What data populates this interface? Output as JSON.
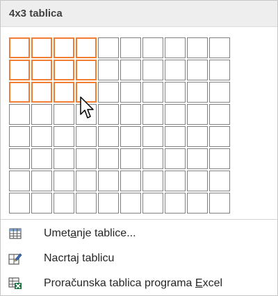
{
  "header": {
    "title": "4x3 tablica"
  },
  "grid": {
    "columns": 10,
    "rows": 8,
    "selected_columns": 4,
    "selected_rows": 3
  },
  "colors": {
    "selected_border": "#f07d33",
    "cell_border": "#7f7f7f",
    "header_bg": "#eeeeee"
  },
  "menu": {
    "items": [
      {
        "pre": "Umet",
        "key": "a",
        "post": "nje tablice...",
        "icon": "insert-table-icon"
      },
      {
        "pre": "Nacrtaj tablicu",
        "key": "",
        "post": "",
        "icon": "draw-table-icon"
      },
      {
        "pre": "Proračunska tablica programa ",
        "key": "E",
        "post": "xcel",
        "icon": "excel-spreadsheet-icon"
      }
    ]
  }
}
